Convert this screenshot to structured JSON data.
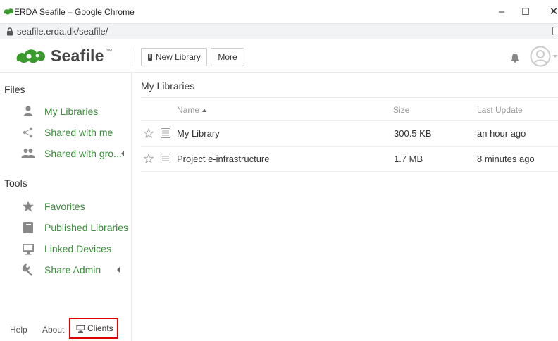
{
  "window": {
    "title": "ERDA Seafile – Google Chrome",
    "minimize": "–",
    "maximize": "☐",
    "close": "✕"
  },
  "address": {
    "url": "seafile.erda.dk/seafile/"
  },
  "header": {
    "logo_text": "Seafile",
    "logo_tm": "™",
    "new_library": "New Library",
    "more": "More"
  },
  "sidebar": {
    "files_heading": "Files",
    "files_items": [
      {
        "label": "My Libraries",
        "icon": "user-icon"
      },
      {
        "label": "Shared with me",
        "icon": "share-icon"
      },
      {
        "label": "Shared with gro...",
        "icon": "group-icon"
      }
    ],
    "tools_heading": "Tools",
    "tools_items": [
      {
        "label": "Favorites",
        "icon": "star-icon"
      },
      {
        "label": "Published Libraries",
        "icon": "book-icon"
      },
      {
        "label": "Linked Devices",
        "icon": "monitor-icon"
      },
      {
        "label": "Share Admin",
        "icon": "wrench-icon"
      }
    ],
    "footer": {
      "help": "Help",
      "about": "About",
      "clients": "Clients"
    }
  },
  "main": {
    "title": "My Libraries",
    "columns": {
      "name": "Name",
      "size": "Size",
      "last_update": "Last Update"
    },
    "rows": [
      {
        "name": "My Library",
        "size": "300.5 KB",
        "last_update": "an hour ago"
      },
      {
        "name": "Project e-infrastructure",
        "size": "1.7 MB",
        "last_update": "8 minutes ago"
      }
    ]
  },
  "colors": {
    "accent_green": "#3a8b3a",
    "logo_green": "#3b9a2e",
    "highlight_red": "#e00000"
  }
}
